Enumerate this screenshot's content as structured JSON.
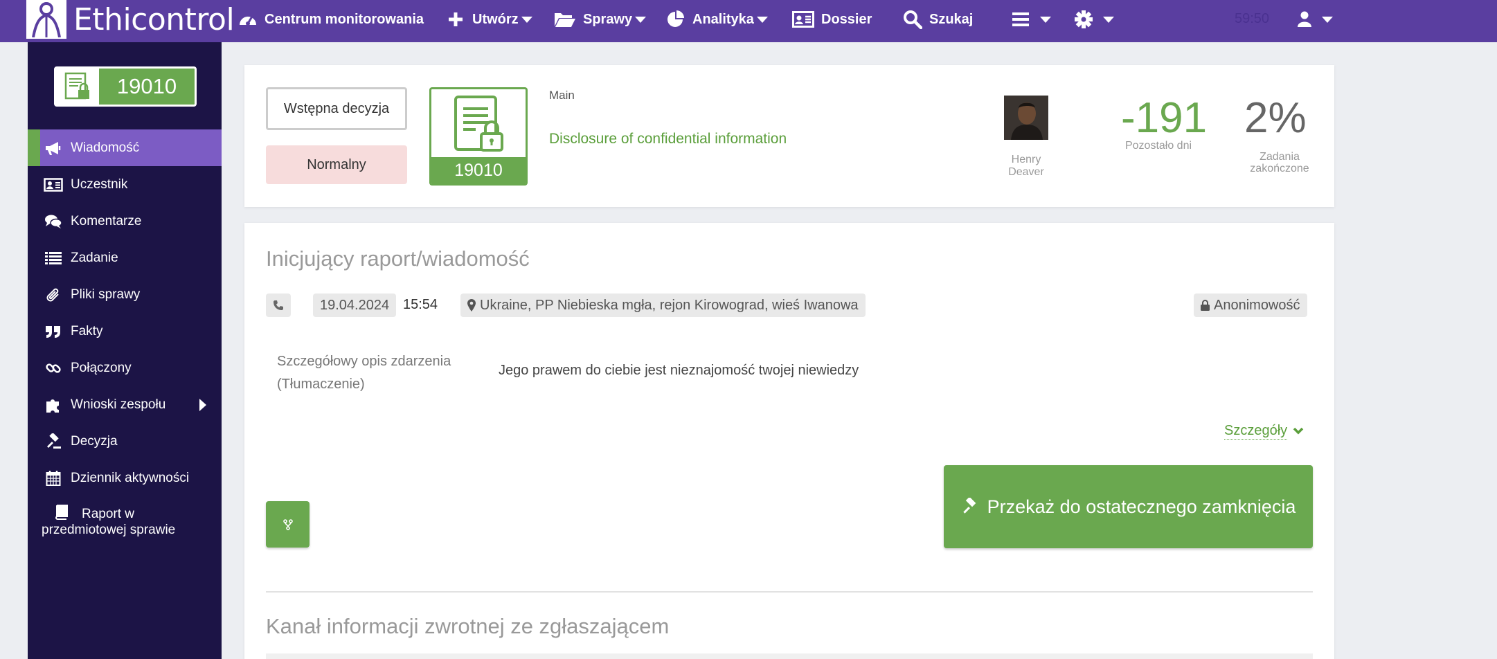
{
  "app": {
    "name": "Ethicontrol",
    "timer": "59:50"
  },
  "nav": {
    "items": [
      {
        "id": "monitoring",
        "label": "Centrum monitorowania",
        "icon": "dashboard-gauge-icon"
      },
      {
        "id": "create",
        "label": "Utwórz",
        "icon": "plus-icon",
        "dropdown": true
      },
      {
        "id": "cases",
        "label": "Sprawy",
        "icon": "folder-open-icon",
        "dropdown": true
      },
      {
        "id": "analytics",
        "label": "Analityka",
        "icon": "pie-chart-icon",
        "dropdown": true
      },
      {
        "id": "dossier",
        "label": "Dossier",
        "icon": "id-card-icon"
      },
      {
        "id": "search",
        "label": "Szukaj",
        "icon": "search-icon"
      }
    ]
  },
  "sidebar": {
    "case_number": "19010",
    "items": [
      {
        "label": "Wiadomość",
        "icon": "megaphone-icon",
        "active": true
      },
      {
        "label": "Uczestnik",
        "icon": "id-card-icon"
      },
      {
        "label": "Komentarze",
        "icon": "comments-icon"
      },
      {
        "label": "Zadanie",
        "icon": "list-icon"
      },
      {
        "label": "Pliki sprawy",
        "icon": "paperclip-icon"
      },
      {
        "label": "Fakty",
        "icon": "quote-icon"
      },
      {
        "label": "Połączony",
        "icon": "link-icon"
      },
      {
        "label": "Wnioski zespołu",
        "icon": "puzzle-icon",
        "submenu": true
      },
      {
        "label": "Decyzja",
        "icon": "gavel-icon"
      },
      {
        "label": "Dziennik aktywności",
        "icon": "calendar-icon"
      },
      {
        "label": "Raport w przedmiotowej sprawie",
        "icon": "book-icon"
      }
    ]
  },
  "case_header": {
    "decision_button": "Wstępna decyzja",
    "priority": "Normalny",
    "case_number": "19010",
    "category": "Main",
    "title": "Disclosure of confidential information",
    "person_name": "Henry Deaver",
    "days_left_value": "-191",
    "days_left_label": "Pozostało dni",
    "tasks_value": "2%",
    "tasks_label": "Zadania zakończone"
  },
  "report": {
    "section_title": "Inicjujący raport/wiadomość",
    "channel_icon": "phone-icon",
    "date": "19.04.2024",
    "time": "15:54",
    "location": "Ukraine, PP Niebieska mgła, rejon Kirowograd, wieś Iwanowa",
    "anonymity": "Anonimowość",
    "field_label": "Szczegółowy opis zdarzenia (Tłumaczenie)",
    "field_value": "Jego prawem do ciebie jest nieznajomość twojej niewiedzy",
    "details_link": "Szczegóły",
    "close_button": "Przekaż do ostatecznego zamknięcia"
  },
  "feedback": {
    "section_title": "Kanał informacji zwrotnej ze zgłaszającem"
  },
  "colors": {
    "topbar": "#5a3ea0",
    "sidebar": "#1c1446",
    "active_item": "#7c5cc4",
    "accent_green": "#6aa84f"
  }
}
